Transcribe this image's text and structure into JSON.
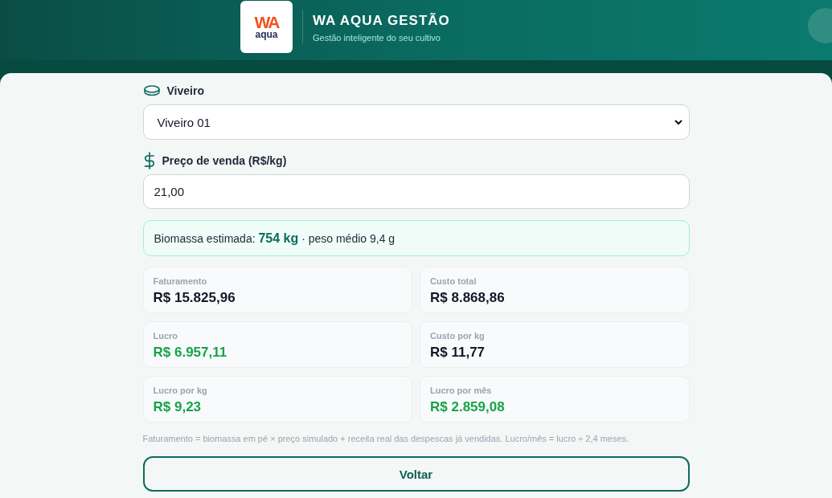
{
  "header": {
    "logo": {
      "top": "WA",
      "bottom": "aqua"
    },
    "title": "WA AQUA GESTÃO",
    "subtitle": "Gestão inteligente do seu cultivo"
  },
  "form": {
    "pond": {
      "label": "Viveiro",
      "value": "Viveiro 01"
    },
    "price": {
      "label": "Preço de venda (R$/kg)",
      "value": "21,00"
    }
  },
  "summary": "Biomassa estimada: **754 kg** · peso médio 9,4 g",
  "metrics": [
    {
      "label": "Faturamento",
      "value": "R$ 15.825,96",
      "color": "#111827"
    },
    {
      "label": "Custo total",
      "value": "R$ 8.868,86",
      "color": "#111827"
    },
    {
      "label": "Lucro",
      "value": "R$ 6.957,11",
      "color": "#16a34a"
    },
    {
      "label": "Custo por kg",
      "value": "R$ 11,77",
      "color": "#111827"
    },
    {
      "label": "Lucro por kg",
      "value": "R$ 9,23",
      "color": "#16a34a"
    },
    {
      "label": "Lucro por mês",
      "value": "R$ 2.859,08",
      "color": "#16a34a"
    }
  ],
  "footnote": "Faturamento = biomassa em pé × preço simulado + receita real das despescas já vendidas. Lucro/mês = lucro ÷ 2,4 meses.",
  "back_button": "Voltar"
}
